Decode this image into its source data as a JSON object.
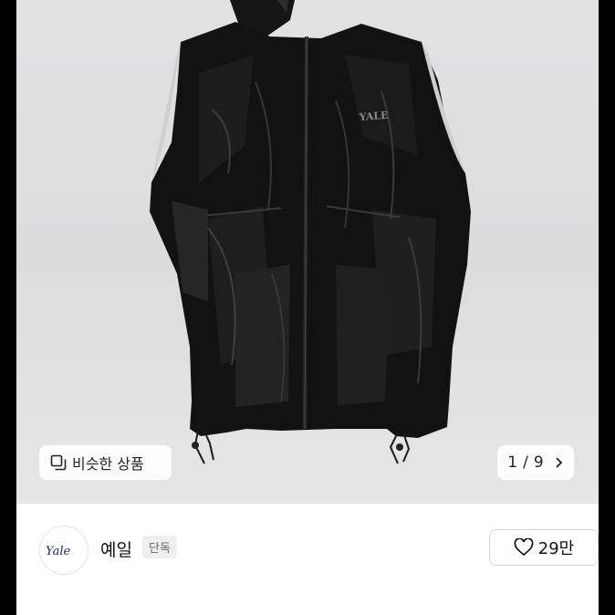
{
  "gallery": {
    "similar_button_label": "비슷한 상품",
    "similar_icon": "copy-stack-icon",
    "pager": {
      "current": "1",
      "separator": "/",
      "total": "9",
      "next_icon": "chevron-right-icon"
    },
    "photo_logo_text": "YALE"
  },
  "shop": {
    "avatar_text": "Yale",
    "name": "예일",
    "badge": "단독"
  },
  "like": {
    "icon": "heart-outline-icon",
    "count": "29만"
  },
  "colors": {
    "background": "#000000",
    "gallery_bg": "#e2e2e3",
    "product": "#111111",
    "badge_bg": "#efefef"
  }
}
